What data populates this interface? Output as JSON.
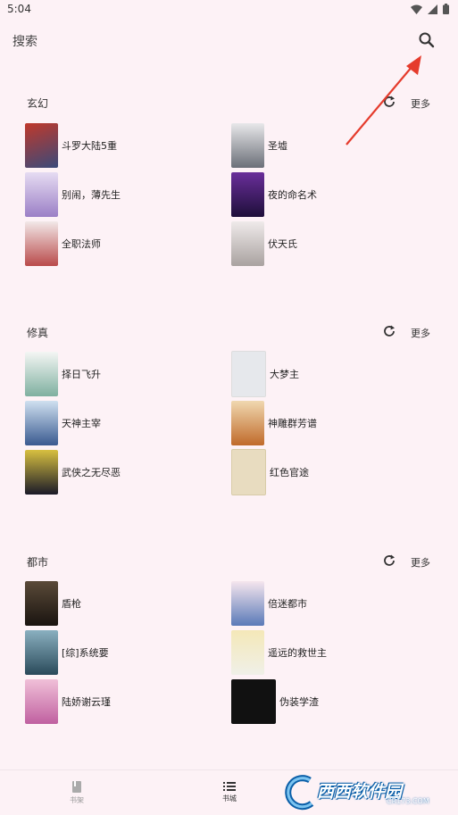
{
  "status": {
    "time": "5:04"
  },
  "search": {
    "label": "搜索"
  },
  "sections": [
    {
      "title": "玄幻",
      "more": "更多",
      "books": [
        {
          "title": "斗罗大陆5重",
          "cover": "#3a4a7a"
        },
        {
          "title": "圣墟",
          "cover": "#6b6f78"
        },
        {
          "title": "别闹，薄先生",
          "cover": "#b9a6d6"
        },
        {
          "title": "夜的命名术",
          "cover": "#3a1f5c"
        },
        {
          "title": "全职法师",
          "cover": "#b94a4a"
        },
        {
          "title": "伏天氏",
          "cover": "#c9c2c0"
        }
      ]
    },
    {
      "title": "修真",
      "more": "更多",
      "books": [
        {
          "title": "择日飞升",
          "cover": "#a9c9c0"
        },
        {
          "title": "大梦主",
          "cover": "#e6e8ec"
        },
        {
          "title": "天神主宰",
          "cover": "#5a7ab0"
        },
        {
          "title": "神雕群芳谱",
          "cover": "#d9a05a"
        },
        {
          "title": "武侠之无尽恶",
          "cover": "#2a2a3a"
        },
        {
          "title": "红色官途",
          "cover": "#e8dcc0"
        }
      ]
    },
    {
      "title": "都市",
      "more": "更多",
      "books": [
        {
          "title": "盾枪",
          "cover": "#3a3028"
        },
        {
          "title": "倍迷都市",
          "cover": "#d98aa0"
        },
        {
          "title": "[综]系统要",
          "cover": "#5a8a9a"
        },
        {
          "title": "遥远的救世主",
          "cover": "#e8d07a"
        },
        {
          "title": "陆娇谢云瑾",
          "cover": "#e0a8c8"
        },
        {
          "title": "伪装学渣",
          "cover": "#111111"
        }
      ]
    }
  ],
  "nav": {
    "shelf": "书架",
    "store": "书城"
  },
  "watermark": {
    "brand": "西西软件园",
    "url": "CR173.COM"
  },
  "colors": {
    "background": "#fdf2f6",
    "arrow": "#e53b2c",
    "watermark": "#0b5fa8"
  }
}
